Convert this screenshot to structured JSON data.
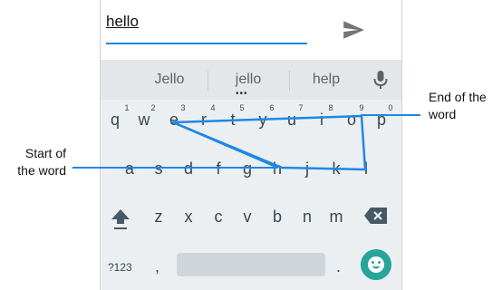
{
  "compose": {
    "text": "hello"
  },
  "suggestions": {
    "items": [
      "Jello",
      "jello",
      "help"
    ],
    "more_indicator": "•••"
  },
  "keyboard": {
    "row1": [
      {
        "letter": "q",
        "hint": "1"
      },
      {
        "letter": "w",
        "hint": "2"
      },
      {
        "letter": "e",
        "hint": "3"
      },
      {
        "letter": "r",
        "hint": "4"
      },
      {
        "letter": "t",
        "hint": "5"
      },
      {
        "letter": "y",
        "hint": "6"
      },
      {
        "letter": "u",
        "hint": "7"
      },
      {
        "letter": "i",
        "hint": "8"
      },
      {
        "letter": "o",
        "hint": "9"
      },
      {
        "letter": "p",
        "hint": "0"
      }
    ],
    "row2": [
      "a",
      "s",
      "d",
      "f",
      "g",
      "h",
      "j",
      "k",
      "l"
    ],
    "row3": [
      "z",
      "x",
      "c",
      "v",
      "b",
      "n",
      "m"
    ],
    "symbols_label": "?123",
    "comma_label": ",",
    "period_label": "."
  },
  "callouts": {
    "start": {
      "line1": "Start of",
      "line2": "the word"
    },
    "end": {
      "line1": "End of the",
      "line2": "word"
    }
  },
  "colors": {
    "accent": "#1e88e5",
    "emoji": "#26a69a",
    "keyboard_bg": "#eceff1"
  },
  "icons": [
    "send-icon",
    "mic-icon",
    "shift-icon",
    "backspace-icon",
    "emoji-icon"
  ]
}
